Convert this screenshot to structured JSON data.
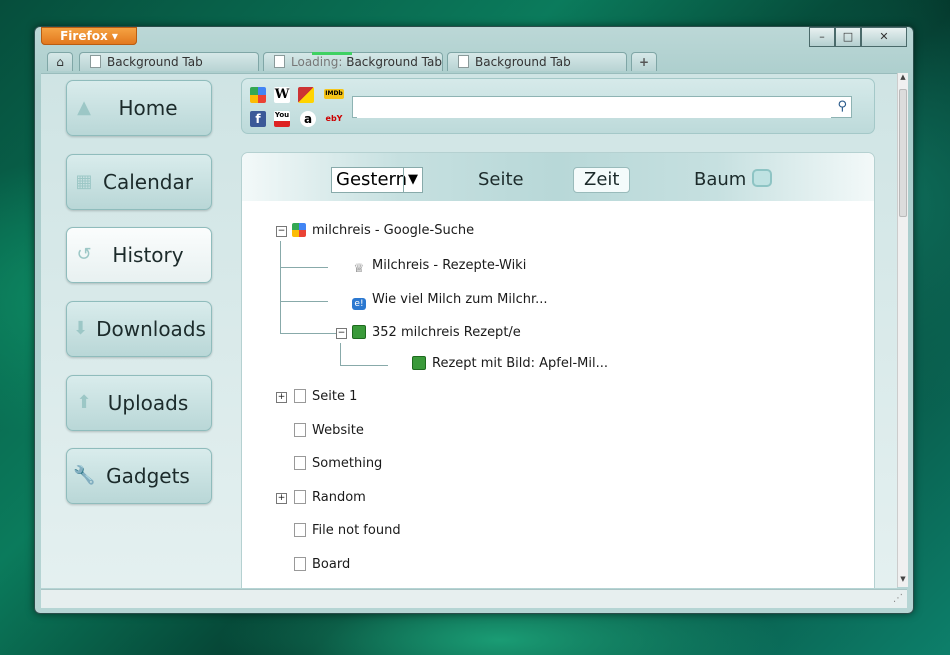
{
  "browser": {
    "app_menu": "Firefox",
    "tabs": [
      {
        "label": "Background Tab",
        "loading": false
      },
      {
        "loading_prefix": "Loading:",
        "label": "Background Tab",
        "loading": true
      },
      {
        "label": "Background Tab",
        "loading": false
      }
    ],
    "new_tab_glyph": "+"
  },
  "sidebar": {
    "items": [
      {
        "label": "Home",
        "icon": "home-icon",
        "active": false
      },
      {
        "label": "Calendar",
        "icon": "calendar-icon",
        "active": false
      },
      {
        "label": "History",
        "icon": "history-icon",
        "active": true
      },
      {
        "label": "Downloads",
        "icon": "download-icon",
        "active": false
      },
      {
        "label": "Uploads",
        "icon": "upload-icon",
        "active": false
      },
      {
        "label": "Gadgets",
        "icon": "wrench-icon",
        "active": false
      }
    ]
  },
  "search": {
    "engines": [
      "google",
      "wikipedia",
      "leo",
      "imdb",
      "facebook",
      "youtube",
      "amazon",
      "ebay"
    ],
    "engine_glyphs": {
      "wikipedia": "W",
      "imdb": "IMDb",
      "facebook": "f",
      "youtube": "You",
      "amazon": "a",
      "ebay": "ebY"
    },
    "value": "",
    "placeholder": ""
  },
  "history_view": {
    "period": "Gestern",
    "views": [
      "Seite",
      "Zeit",
      "Baum"
    ],
    "selected_view": "Zeit",
    "tree": [
      {
        "label": "milchreis - Google-Suche",
        "icon": "google-icon",
        "expander": "−"
      },
      {
        "label": "Milchreis - Rezepte-Wiki",
        "icon": "chef-hat-icon"
      },
      {
        "label": "Wie viel Milch zum Milchr...",
        "icon": "answers-icon"
      },
      {
        "label": "352 milchreis Rezept/e",
        "icon": "chefkoch-icon",
        "expander": "−"
      },
      {
        "label": "Rezept mit Bild: Apfel-Mil...",
        "icon": "chefkoch-icon"
      },
      {
        "label": "Seite 1",
        "icon": "page-icon",
        "expander": "+"
      },
      {
        "label": "Website",
        "icon": "page-icon"
      },
      {
        "label": "Something",
        "icon": "page-icon"
      },
      {
        "label": "Random",
        "icon": "page-icon",
        "expander": "+"
      },
      {
        "label": "File not found",
        "icon": "page-icon"
      },
      {
        "label": "Board",
        "icon": "page-icon"
      }
    ]
  },
  "colors": {
    "accent": "#e1761c",
    "panel": "#bcd8d7",
    "loading_bar": "#3fd163"
  }
}
